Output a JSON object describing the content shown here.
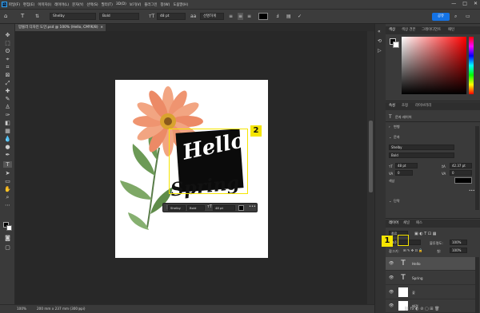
{
  "menubar": {
    "logo": "Ps",
    "items": [
      "파일(F)",
      "편집(E)",
      "이미지(I)",
      "레이어(L)",
      "문자(Y)",
      "선택(S)",
      "필터(T)",
      "3D(D)",
      "보기(V)",
      "플러그인",
      "창(W)",
      "도움말(H)"
    ],
    "window_controls": [
      "—",
      "□",
      "✕"
    ]
  },
  "optionbar": {
    "font_family": "Shelby",
    "font_style": "Bold",
    "font_size": "48 pt",
    "antialias": "선명하게",
    "share_label": "공유",
    "text_color": "#000000"
  },
  "document_tab": {
    "title": "망블러 디자인 도안.psd @ 100% (Hello, CMYK/8)",
    "close": "×"
  },
  "canvas": {
    "hello_text": "Hello",
    "spring_text": "Spring",
    "callout_1": "1",
    "callout_2": "2",
    "floating_bar": {
      "font": "Shelby",
      "style": "Bold",
      "size": "48 pt",
      "more": "•••"
    }
  },
  "statusbar": {
    "zoom": "100%",
    "doc_info": "200 mm x 237 mm (300 ppi)"
  },
  "color_panel": {
    "tabs": [
      "색상",
      "색상 견본",
      "그레이디언트",
      "패턴"
    ]
  },
  "properties_panel": {
    "tabs": [
      "속성",
      "조정",
      "라이브러리"
    ],
    "layer_type": "문자 레이어",
    "transform_label": "변형",
    "character_label": "문자",
    "font": "Shelby",
    "style": "Bold",
    "size": "48 pt",
    "leading": "42.37 pt",
    "tracking": "0",
    "kerning": "0",
    "paragraph_label": "단락",
    "more": "•••"
  },
  "layers_panel": {
    "tabs": [
      "레이어",
      "채널",
      "패스"
    ],
    "kind_label": "종류",
    "blend_mode": "표준",
    "opacity_label": "불투명도:",
    "opacity": "100%",
    "lock_label": "잠그기:",
    "fill_label": "칠:",
    "fill": "100%",
    "layers": [
      {
        "name": "Hello",
        "type": "text",
        "selected": true
      },
      {
        "name": "Spring",
        "type": "text",
        "selected": false
      },
      {
        "name": "꽃",
        "type": "image",
        "selected": false
      },
      {
        "name": "배경",
        "type": "image",
        "selected": false
      }
    ]
  },
  "colors": {
    "accent": "#1473e6",
    "callout": "#f5e500"
  }
}
